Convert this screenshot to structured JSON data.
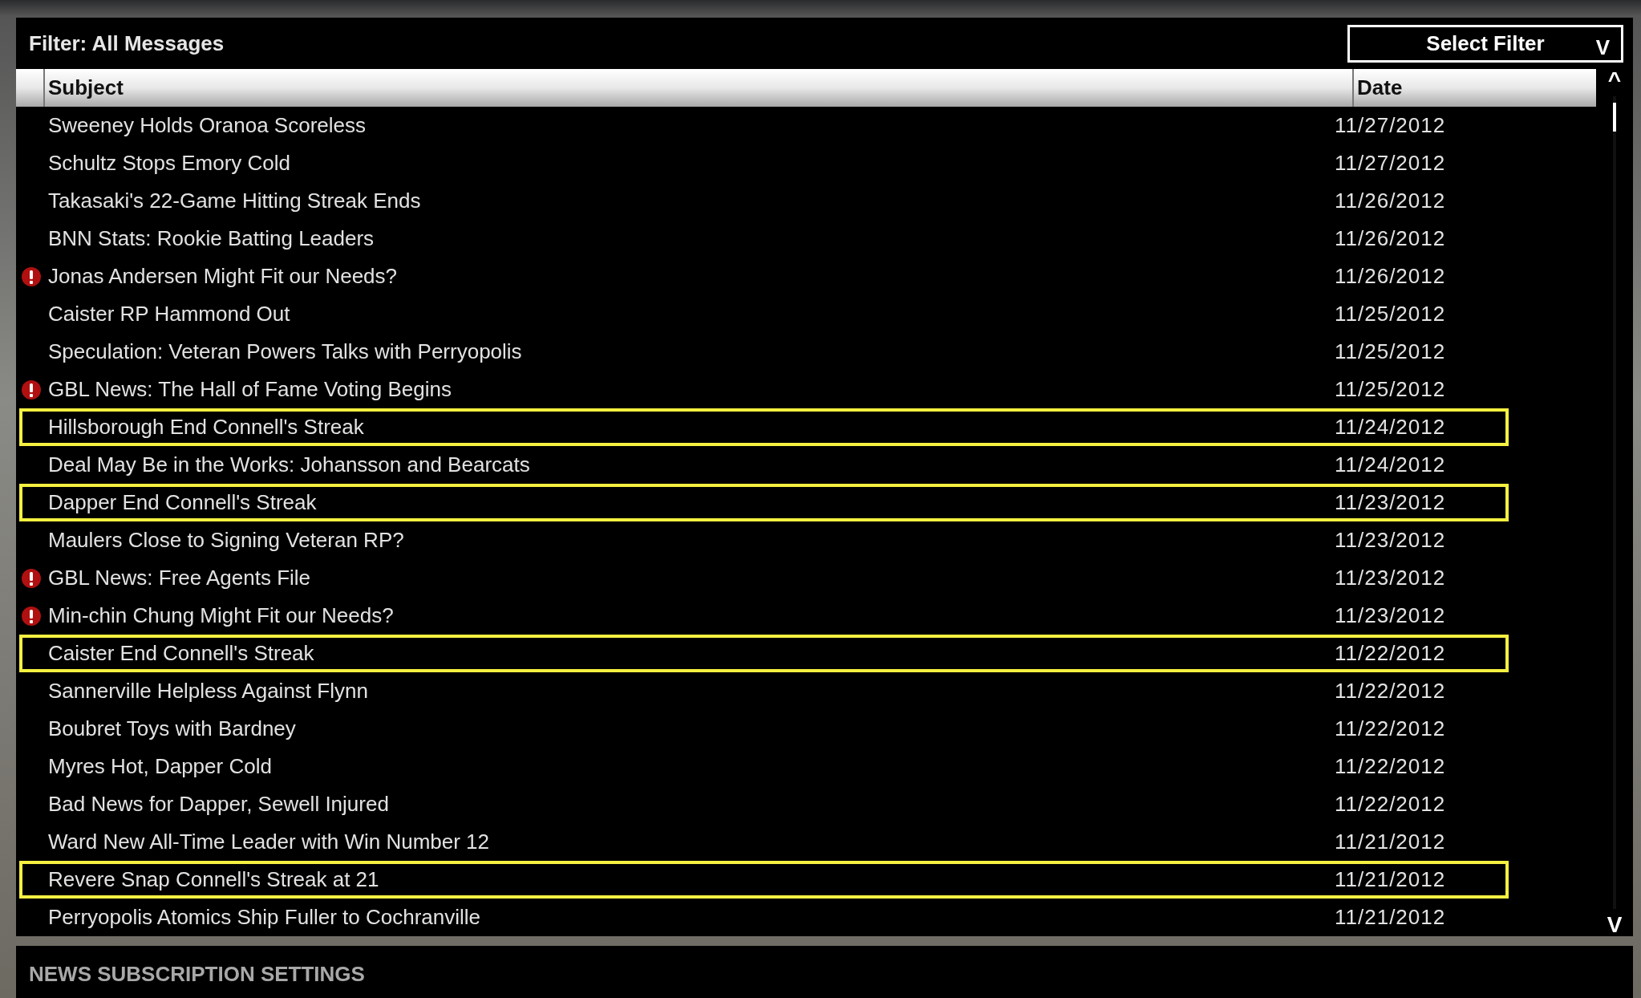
{
  "filter": {
    "label": "Filter: All Messages",
    "select_label": "Select Filter",
    "select_caret": "V"
  },
  "table": {
    "columns": [
      "Subject",
      "Date"
    ],
    "rows": [
      {
        "subject": "Sweeney Holds Oranoa Scoreless",
        "date": "11/27/2012",
        "important": false,
        "highlighted": false
      },
      {
        "subject": "Schultz Stops Emory Cold",
        "date": "11/27/2012",
        "important": false,
        "highlighted": false
      },
      {
        "subject": "Takasaki's 22-Game Hitting Streak Ends",
        "date": "11/26/2012",
        "important": false,
        "highlighted": false
      },
      {
        "subject": "BNN Stats: Rookie Batting Leaders",
        "date": "11/26/2012",
        "important": false,
        "highlighted": false
      },
      {
        "subject": "Jonas Andersen Might Fit our Needs?",
        "date": "11/26/2012",
        "important": true,
        "highlighted": false
      },
      {
        "subject": "Caister RP Hammond Out",
        "date": "11/25/2012",
        "important": false,
        "highlighted": false
      },
      {
        "subject": "Speculation: Veteran Powers Talks with Perryopolis",
        "date": "11/25/2012",
        "important": false,
        "highlighted": false
      },
      {
        "subject": "GBL News: The Hall of Fame Voting Begins",
        "date": "11/25/2012",
        "important": true,
        "highlighted": false
      },
      {
        "subject": "Hillsborough End Connell's Streak",
        "date": "11/24/2012",
        "important": false,
        "highlighted": true
      },
      {
        "subject": "Deal May Be in the Works: Johansson and Bearcats",
        "date": "11/24/2012",
        "important": false,
        "highlighted": false
      },
      {
        "subject": "Dapper End Connell's Streak",
        "date": "11/23/2012",
        "important": false,
        "highlighted": true
      },
      {
        "subject": "Maulers Close to Signing Veteran RP?",
        "date": "11/23/2012",
        "important": false,
        "highlighted": false
      },
      {
        "subject": "GBL News: Free Agents File",
        "date": "11/23/2012",
        "important": true,
        "highlighted": false
      },
      {
        "subject": "Min-chin Chung Might Fit our Needs?",
        "date": "11/23/2012",
        "important": true,
        "highlighted": false
      },
      {
        "subject": "Caister End Connell's Streak",
        "date": "11/22/2012",
        "important": false,
        "highlighted": true
      },
      {
        "subject": "Sannerville Helpless Against Flynn",
        "date": "11/22/2012",
        "important": false,
        "highlighted": false
      },
      {
        "subject": "Boubret Toys with Bardney",
        "date": "11/22/2012",
        "important": false,
        "highlighted": false
      },
      {
        "subject": "Myres Hot, Dapper Cold",
        "date": "11/22/2012",
        "important": false,
        "highlighted": false
      },
      {
        "subject": "Bad News for Dapper, Sewell Injured",
        "date": "11/22/2012",
        "important": false,
        "highlighted": false
      },
      {
        "subject": "Ward New All-Time Leader with Win Number 12",
        "date": "11/21/2012",
        "important": false,
        "highlighted": false
      },
      {
        "subject": "Revere Snap Connell's Streak at 21",
        "date": "11/21/2012",
        "important": false,
        "highlighted": true
      },
      {
        "subject": "Perryopolis Atomics Ship Fuller to Cochranville",
        "date": "11/21/2012",
        "important": false,
        "highlighted": false
      }
    ]
  },
  "scrollbar": {
    "up": "^",
    "down": "V"
  },
  "footer": {
    "title": "NEWS SUBSCRIPTION SETTINGS"
  }
}
